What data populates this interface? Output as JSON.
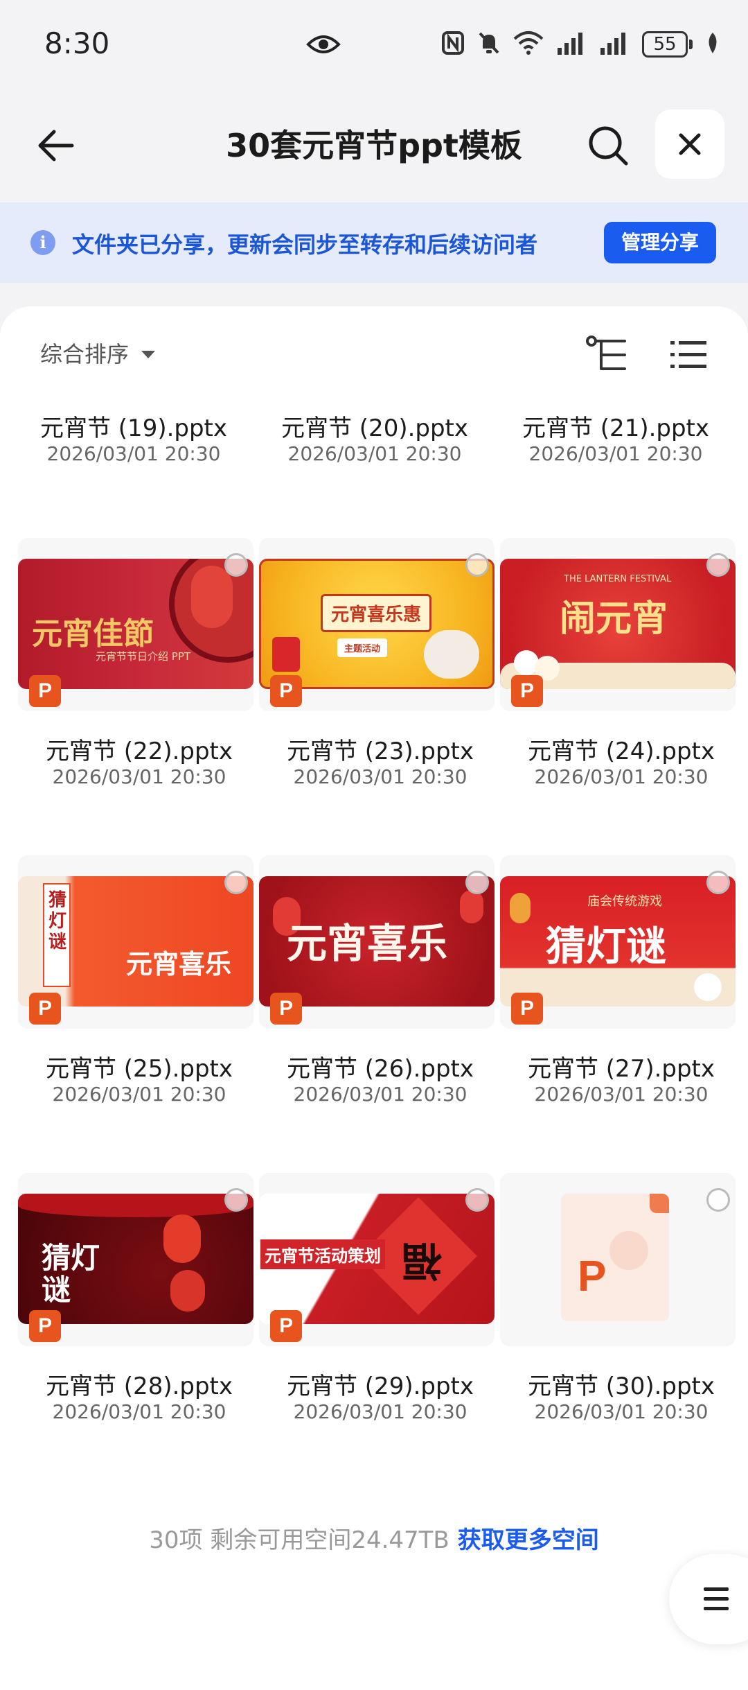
{
  "status": {
    "time": "8:30",
    "battery": "55"
  },
  "header": {
    "title": "30套元宵节ppt模板"
  },
  "banner": {
    "info_icon_glyph": "i",
    "text": "文件夹已分享，更新会同步至转存和后续访问者",
    "manage_button": "管理分享"
  },
  "toolbar": {
    "sort_label": "综合排序"
  },
  "top_row": [
    {
      "name": "元宵节 (19).pptx",
      "date": "2026/03/01 20:30"
    },
    {
      "name": "元宵节 (20).pptx",
      "date": "2026/03/01 20:30"
    },
    {
      "name": "元宵节 (21).pptx",
      "date": "2026/03/01 20:30"
    }
  ],
  "files": [
    {
      "name": "元宵节 (22).pptx",
      "date": "2026/03/01 20:30",
      "badge": "P",
      "thumb_text": "元宵佳節",
      "thumb_sub": "元宵节节日介绍 PPT"
    },
    {
      "name": "元宵节 (23).pptx",
      "date": "2026/03/01 20:30",
      "badge": "P",
      "thumb_text": "元宵喜乐惠",
      "thumb_sub": "主题活动"
    },
    {
      "name": "元宵节 (24).pptx",
      "date": "2026/03/01 20:30",
      "badge": "P",
      "thumb_text": "闹元宵",
      "thumb_sub": "THE LANTERN FESTIVAL"
    },
    {
      "name": "元宵节 (25).pptx",
      "date": "2026/03/01 20:30",
      "badge": "P",
      "thumb_text": "元宵喜乐",
      "thumb_sub": "猜灯谜"
    },
    {
      "name": "元宵节 (26).pptx",
      "date": "2026/03/01 20:30",
      "badge": "P",
      "thumb_text": "元宵喜乐",
      "thumb_sub": ""
    },
    {
      "name": "元宵节 (27).pptx",
      "date": "2026/03/01 20:30",
      "badge": "P",
      "thumb_text": "猜灯谜",
      "thumb_sub": "庙会传统游戏"
    },
    {
      "name": "元宵节 (28).pptx",
      "date": "2026/03/01 20:30",
      "badge": "P",
      "thumb_text": "猜灯谜",
      "thumb_sub": ""
    },
    {
      "name": "元宵节 (29).pptx",
      "date": "2026/03/01 20:30",
      "badge": "P",
      "thumb_text": "元宵节活动策划",
      "thumb_sub": "福"
    },
    {
      "name": "元宵节 (30).pptx",
      "date": "2026/03/01 20:30",
      "badge": "P",
      "thumb_text": "",
      "thumb_sub": ""
    }
  ],
  "footer": {
    "summary": "30项 剩余可用空间24.47TB",
    "link": "获取更多空间"
  },
  "colors": {
    "accent": "#1a5cf0",
    "ppt_badge": "#e8541d",
    "banner_bg": "#e6ebfb"
  }
}
